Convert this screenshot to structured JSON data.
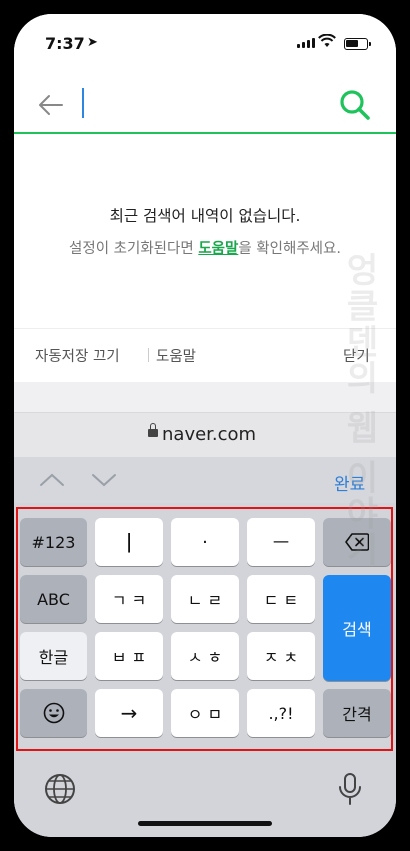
{
  "status": {
    "time": "7:37",
    "location_icon": "location-arrow-icon"
  },
  "search": {
    "placeholder": "",
    "value": "",
    "back_icon": "back-arrow-icon",
    "search_icon": "search-icon",
    "accent": "#1fc35c"
  },
  "message": {
    "line1": "최근 검색어 내역이 없습니다.",
    "line2_prefix": "설정이 초기화된다면 ",
    "line2_link": "도움말",
    "line2_suffix": "을 확인해주세요."
  },
  "actions": {
    "autosave_off": "자동저장 끄기",
    "help": "도움말",
    "close": "닫기"
  },
  "browser": {
    "url": "naver.com"
  },
  "keyboard_toolbar": {
    "done": "완료"
  },
  "keyboard": {
    "rows": [
      [
        "#123",
        "ㅣ",
        "·",
        "ㅡ",
        "backspace"
      ],
      [
        "ABC",
        "ㄱ ㅋ",
        "ㄴ ㄹ",
        "ㄷ ㅌ"
      ],
      [
        "한글",
        "ㅂ ㅍ",
        "ㅅ ㅎ",
        "ㅈ ㅊ"
      ],
      [
        "emoji",
        "→",
        "ㅇ ㅁ",
        ".,?!",
        "간격"
      ]
    ],
    "search_key": "검색",
    "accent": "#1e88f0"
  },
  "watermark": "엉클덴의 웹 이야기"
}
